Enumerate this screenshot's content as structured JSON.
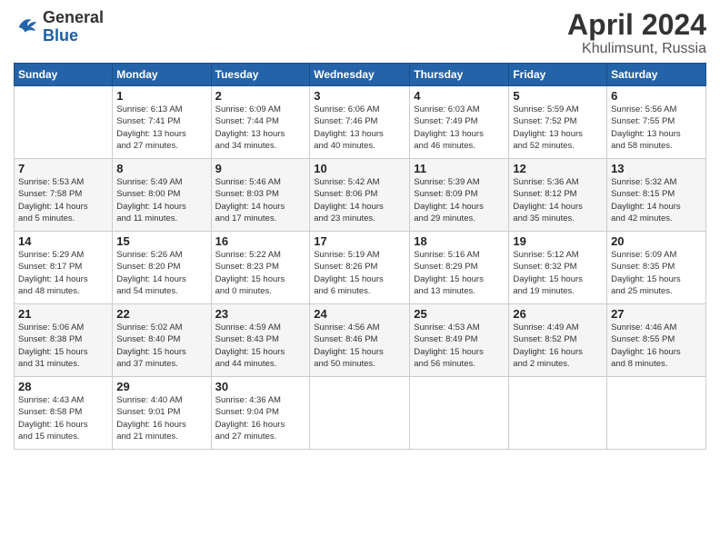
{
  "header": {
    "logo_general": "General",
    "logo_blue": "Blue",
    "month": "April 2024",
    "location": "Khulimsunt, Russia"
  },
  "weekdays": [
    "Sunday",
    "Monday",
    "Tuesday",
    "Wednesday",
    "Thursday",
    "Friday",
    "Saturday"
  ],
  "weeks": [
    [
      {
        "day": "",
        "info": ""
      },
      {
        "day": "1",
        "info": "Sunrise: 6:13 AM\nSunset: 7:41 PM\nDaylight: 13 hours\nand 27 minutes."
      },
      {
        "day": "2",
        "info": "Sunrise: 6:09 AM\nSunset: 7:44 PM\nDaylight: 13 hours\nand 34 minutes."
      },
      {
        "day": "3",
        "info": "Sunrise: 6:06 AM\nSunset: 7:46 PM\nDaylight: 13 hours\nand 40 minutes."
      },
      {
        "day": "4",
        "info": "Sunrise: 6:03 AM\nSunset: 7:49 PM\nDaylight: 13 hours\nand 46 minutes."
      },
      {
        "day": "5",
        "info": "Sunrise: 5:59 AM\nSunset: 7:52 PM\nDaylight: 13 hours\nand 52 minutes."
      },
      {
        "day": "6",
        "info": "Sunrise: 5:56 AM\nSunset: 7:55 PM\nDaylight: 13 hours\nand 58 minutes."
      }
    ],
    [
      {
        "day": "7",
        "info": "Sunrise: 5:53 AM\nSunset: 7:58 PM\nDaylight: 14 hours\nand 5 minutes."
      },
      {
        "day": "8",
        "info": "Sunrise: 5:49 AM\nSunset: 8:00 PM\nDaylight: 14 hours\nand 11 minutes."
      },
      {
        "day": "9",
        "info": "Sunrise: 5:46 AM\nSunset: 8:03 PM\nDaylight: 14 hours\nand 17 minutes."
      },
      {
        "day": "10",
        "info": "Sunrise: 5:42 AM\nSunset: 8:06 PM\nDaylight: 14 hours\nand 23 minutes."
      },
      {
        "day": "11",
        "info": "Sunrise: 5:39 AM\nSunset: 8:09 PM\nDaylight: 14 hours\nand 29 minutes."
      },
      {
        "day": "12",
        "info": "Sunrise: 5:36 AM\nSunset: 8:12 PM\nDaylight: 14 hours\nand 35 minutes."
      },
      {
        "day": "13",
        "info": "Sunrise: 5:32 AM\nSunset: 8:15 PM\nDaylight: 14 hours\nand 42 minutes."
      }
    ],
    [
      {
        "day": "14",
        "info": "Sunrise: 5:29 AM\nSunset: 8:17 PM\nDaylight: 14 hours\nand 48 minutes."
      },
      {
        "day": "15",
        "info": "Sunrise: 5:26 AM\nSunset: 8:20 PM\nDaylight: 14 hours\nand 54 minutes."
      },
      {
        "day": "16",
        "info": "Sunrise: 5:22 AM\nSunset: 8:23 PM\nDaylight: 15 hours\nand 0 minutes."
      },
      {
        "day": "17",
        "info": "Sunrise: 5:19 AM\nSunset: 8:26 PM\nDaylight: 15 hours\nand 6 minutes."
      },
      {
        "day": "18",
        "info": "Sunrise: 5:16 AM\nSunset: 8:29 PM\nDaylight: 15 hours\nand 13 minutes."
      },
      {
        "day": "19",
        "info": "Sunrise: 5:12 AM\nSunset: 8:32 PM\nDaylight: 15 hours\nand 19 minutes."
      },
      {
        "day": "20",
        "info": "Sunrise: 5:09 AM\nSunset: 8:35 PM\nDaylight: 15 hours\nand 25 minutes."
      }
    ],
    [
      {
        "day": "21",
        "info": "Sunrise: 5:06 AM\nSunset: 8:38 PM\nDaylight: 15 hours\nand 31 minutes."
      },
      {
        "day": "22",
        "info": "Sunrise: 5:02 AM\nSunset: 8:40 PM\nDaylight: 15 hours\nand 37 minutes."
      },
      {
        "day": "23",
        "info": "Sunrise: 4:59 AM\nSunset: 8:43 PM\nDaylight: 15 hours\nand 44 minutes."
      },
      {
        "day": "24",
        "info": "Sunrise: 4:56 AM\nSunset: 8:46 PM\nDaylight: 15 hours\nand 50 minutes."
      },
      {
        "day": "25",
        "info": "Sunrise: 4:53 AM\nSunset: 8:49 PM\nDaylight: 15 hours\nand 56 minutes."
      },
      {
        "day": "26",
        "info": "Sunrise: 4:49 AM\nSunset: 8:52 PM\nDaylight: 16 hours\nand 2 minutes."
      },
      {
        "day": "27",
        "info": "Sunrise: 4:46 AM\nSunset: 8:55 PM\nDaylight: 16 hours\nand 8 minutes."
      }
    ],
    [
      {
        "day": "28",
        "info": "Sunrise: 4:43 AM\nSunset: 8:58 PM\nDaylight: 16 hours\nand 15 minutes."
      },
      {
        "day": "29",
        "info": "Sunrise: 4:40 AM\nSunset: 9:01 PM\nDaylight: 16 hours\nand 21 minutes."
      },
      {
        "day": "30",
        "info": "Sunrise: 4:36 AM\nSunset: 9:04 PM\nDaylight: 16 hours\nand 27 minutes."
      },
      {
        "day": "",
        "info": ""
      },
      {
        "day": "",
        "info": ""
      },
      {
        "day": "",
        "info": ""
      },
      {
        "day": "",
        "info": ""
      }
    ]
  ]
}
